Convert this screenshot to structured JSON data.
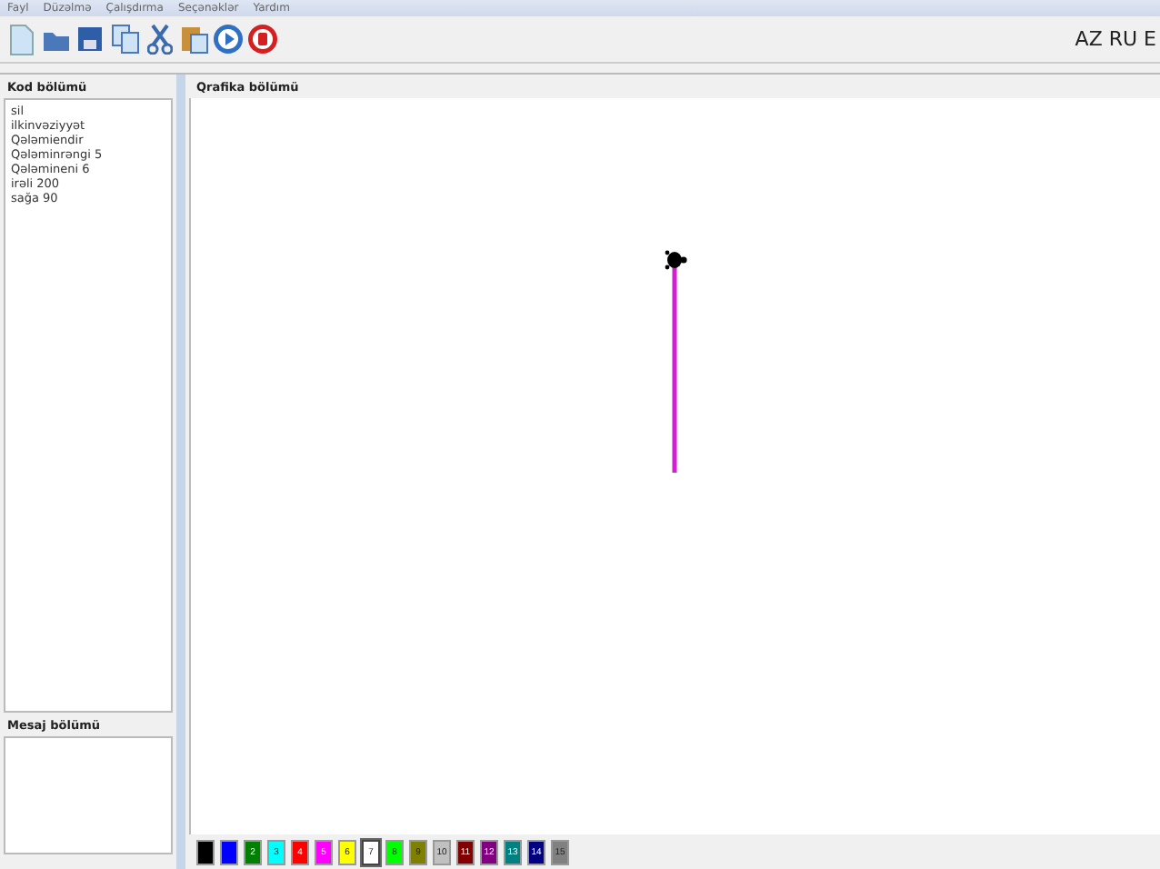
{
  "menu": [
    "Fayl",
    "Düzəlmə",
    "Çalışdırma",
    "Seçənəklər",
    "Yardım"
  ],
  "toolbar": [
    {
      "kind": "new"
    },
    {
      "kind": "open"
    },
    {
      "kind": "save"
    },
    {
      "kind": "copy"
    },
    {
      "kind": "cut"
    },
    {
      "kind": "paste"
    },
    {
      "kind": "run"
    },
    {
      "kind": "stop"
    }
  ],
  "languages": "AZ RU E",
  "code_panel": {
    "title": "Kod bölümü",
    "lines": [
      "sil",
      "ilkinvəziyyət",
      "Qələmiendir",
      "Qələminrəngi 5",
      "Qələmineni 6",
      "irəli 200",
      "sağa 90"
    ]
  },
  "message_panel": {
    "title": "Mesaj bölümü"
  },
  "graphics_panel": {
    "title": "Qrafika bölümü"
  },
  "palette": [
    {
      "color": "#000000",
      "selected": false
    },
    {
      "color": "#0000ff",
      "selected": false
    },
    {
      "color": "#008000",
      "label": "2",
      "selected": false
    },
    {
      "color": "#00ffff",
      "label": "3",
      "selected": false
    },
    {
      "color": "#ff0000",
      "label": "4",
      "selected": false
    },
    {
      "color": "#ff00ff",
      "label": "5",
      "selected": false
    },
    {
      "color": "#ffff00",
      "label": "6",
      "selected": false
    },
    {
      "color": "#ffffff",
      "label": "7",
      "selected": true
    },
    {
      "color": "#00ff00",
      "label": "8",
      "selected": false
    },
    {
      "color": "#808000",
      "label": "9",
      "selected": false
    },
    {
      "color": "#c0c0c0",
      "label": "10",
      "selected": false
    },
    {
      "color": "#800000",
      "label": "11",
      "selected": false
    },
    {
      "color": "#800080",
      "label": "12",
      "selected": false
    },
    {
      "color": "#008080",
      "label": "13",
      "selected": false
    },
    {
      "color": "#000080",
      "label": "14",
      "selected": false
    },
    {
      "color": "#808080",
      "label": "15",
      "selected": false
    }
  ]
}
